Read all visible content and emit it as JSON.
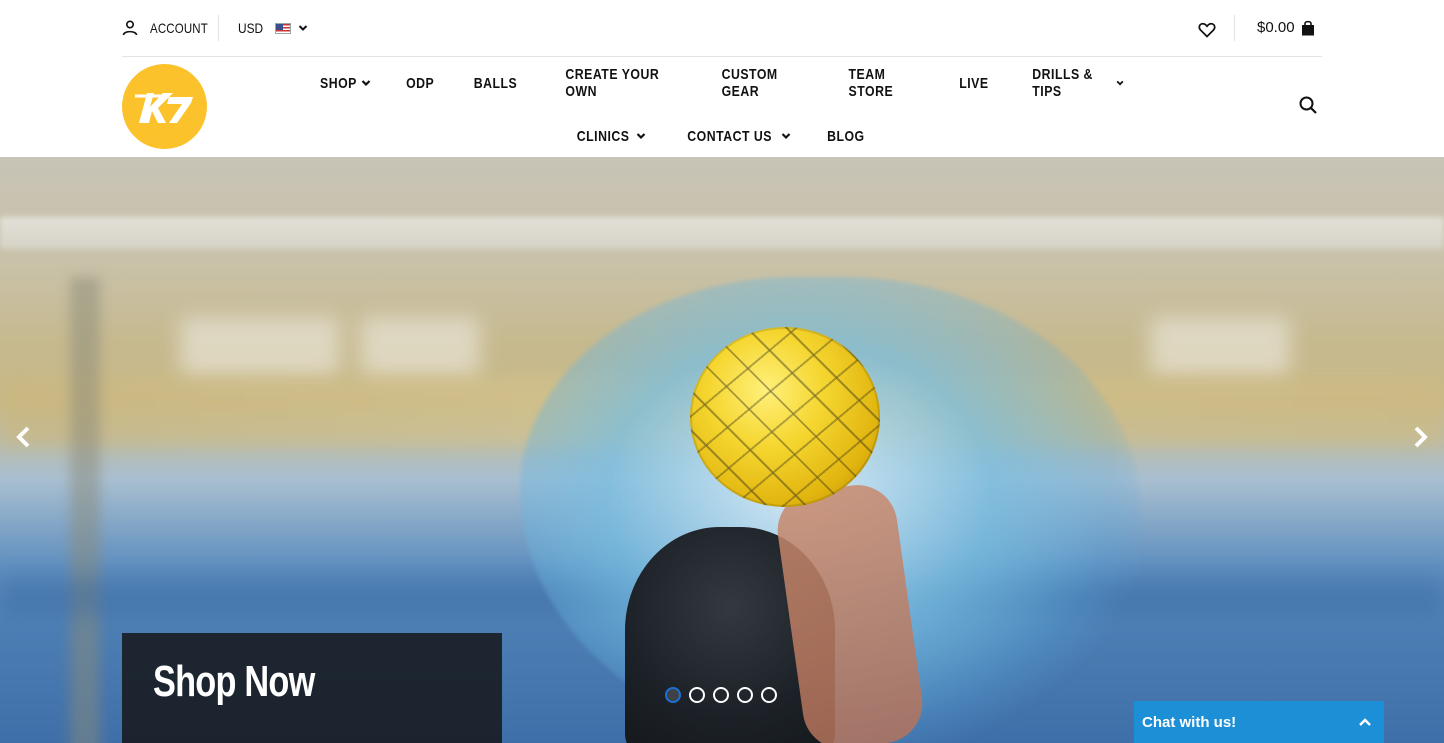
{
  "topbar": {
    "account_label": "ACCOUNT",
    "currency_label": "USD",
    "cart_total": "$0.00"
  },
  "nav": {
    "row1": [
      {
        "label": "SHOP",
        "dropdown": true
      },
      {
        "label": "ODP",
        "dropdown": false
      },
      {
        "label": "BALLS",
        "dropdown": false
      },
      {
        "label": "CREATE YOUR OWN",
        "dropdown": false
      },
      {
        "label": "CUSTOM GEAR",
        "dropdown": false
      },
      {
        "label": "TEAM STORE",
        "dropdown": false
      },
      {
        "label": "LIVE",
        "dropdown": false
      },
      {
        "label": "DRILLS & TIPS",
        "dropdown": true
      }
    ],
    "row2": [
      {
        "label": "CLINICS",
        "dropdown": true
      },
      {
        "label": "CONTACT US",
        "dropdown": true
      },
      {
        "label": "BLOG",
        "dropdown": false
      }
    ]
  },
  "hero": {
    "promo_title": "Shop Now",
    "slide_count": 5,
    "active_slide": 1
  },
  "chat": {
    "label": "Chat with us!"
  },
  "colors": {
    "brand_yellow": "#fcc22c",
    "chat_blue": "#1c8fd6",
    "active_dot": "#1c6fd6"
  },
  "icons": {
    "account": "user-icon",
    "wishlist": "heart-icon",
    "cart": "shopping-bag-icon",
    "search": "search-icon",
    "prev": "chevron-left-icon",
    "next": "chevron-right-icon",
    "chat_toggle": "chevron-up-icon"
  }
}
